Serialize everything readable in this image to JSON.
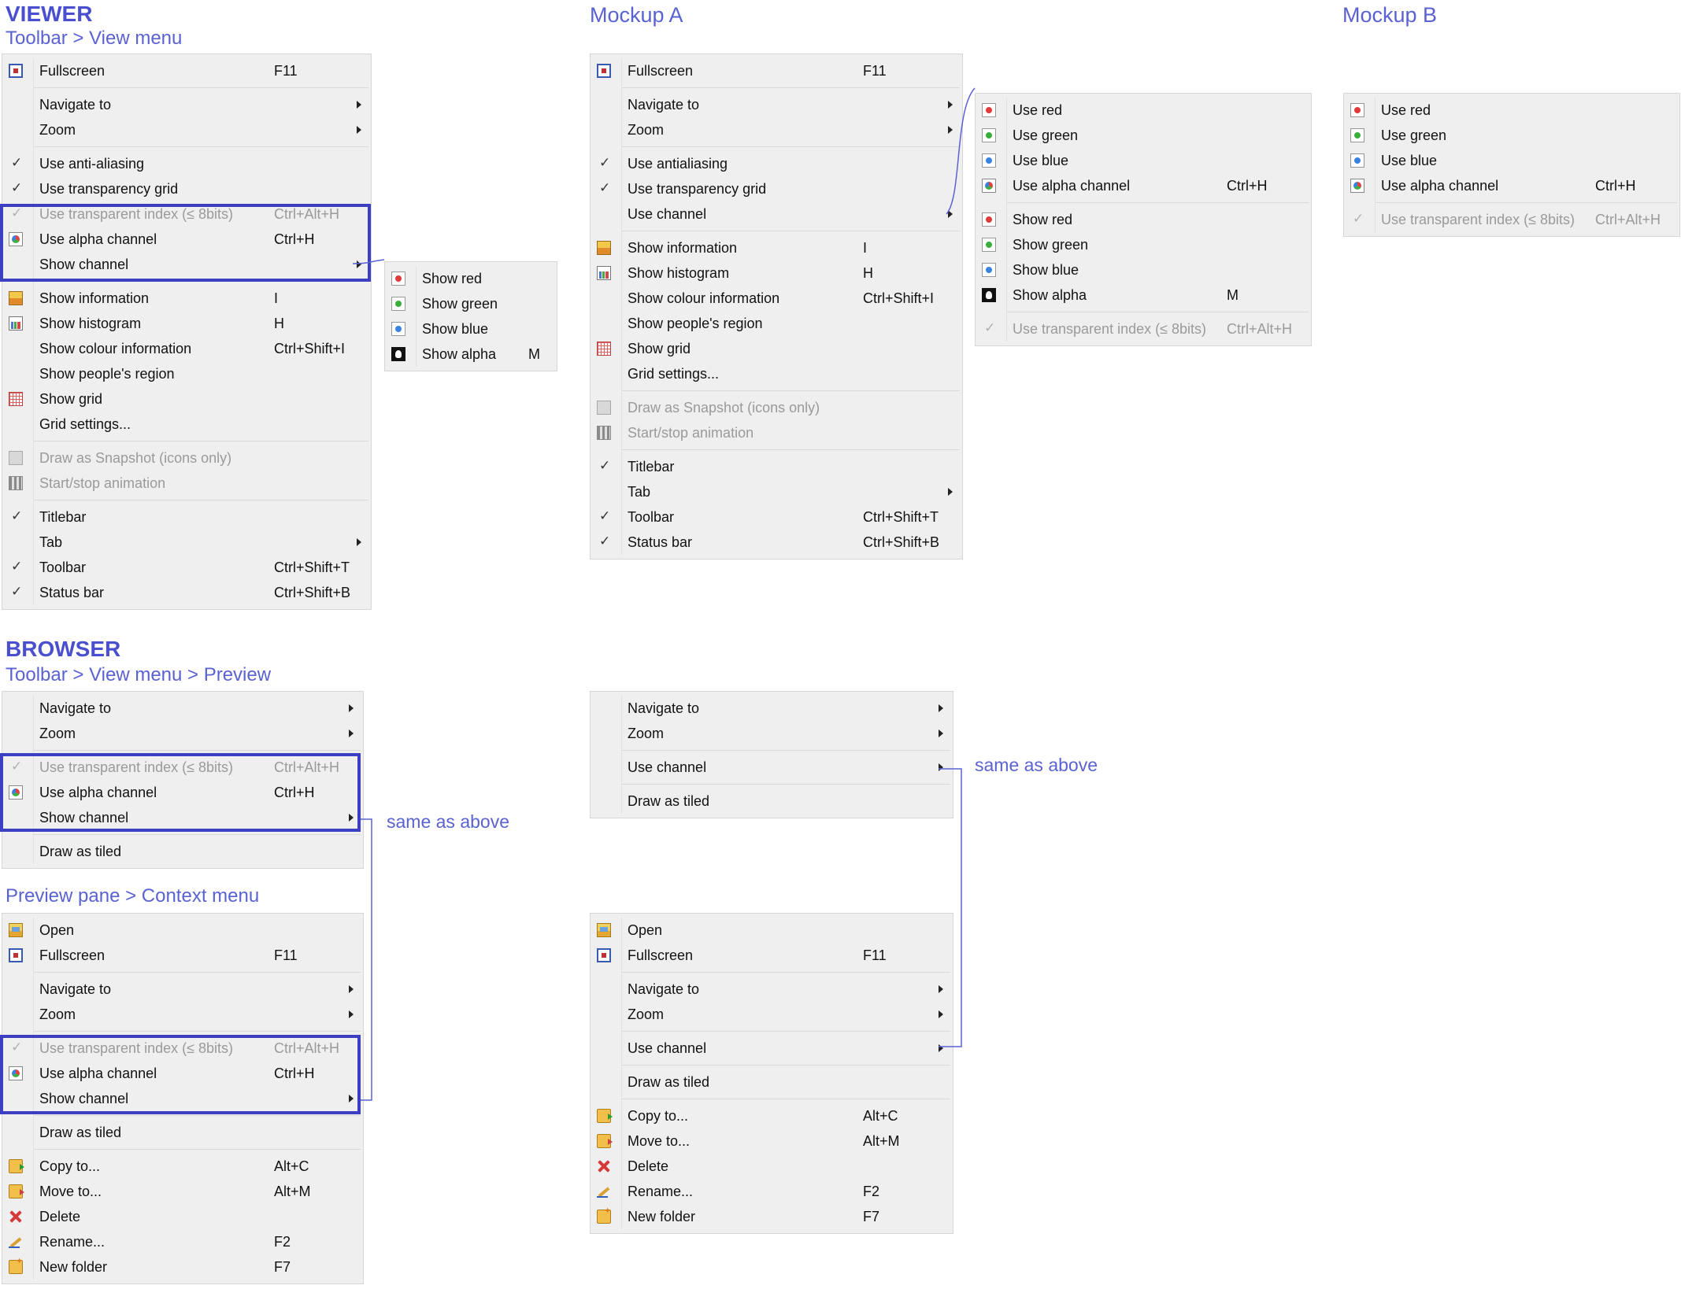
{
  "headings": {
    "viewer": "VIEWER",
    "viewer_path": "Toolbar > View menu",
    "browser": "BROWSER",
    "browser_path": "Toolbar > View menu > Preview",
    "preview_path": "Preview pane > Context menu",
    "mockup_a": "Mockup A",
    "mockup_b": "Mockup B"
  },
  "notes": {
    "same_as_above": "same as above"
  },
  "labels": {
    "fullscreen": "Fullscreen",
    "navigate_to": "Navigate to",
    "zoom": "Zoom",
    "use_anti_aliasing": "Use anti-aliasing",
    "use_antialiasing": "Use antialiasing",
    "use_transparency_grid": "Use transparency grid",
    "use_transparent_index": "Use transparent index (≤ 8bits)",
    "use_alpha_channel": "Use alpha channel",
    "show_channel": "Show channel",
    "use_channel": "Use channel",
    "show_information": "Show information",
    "show_histogram": "Show histogram",
    "show_colour_information": "Show colour information",
    "show_peoples_region": "Show people's region",
    "show_grid": "Show grid",
    "grid_settings": "Grid settings...",
    "draw_as_snapshot": "Draw as Snapshot (icons only)",
    "start_stop_animation": "Start/stop animation",
    "titlebar": "Titlebar",
    "tab": "Tab",
    "toolbar": "Toolbar",
    "status_bar": "Status bar",
    "show_red": "Show red",
    "show_green": "Show green",
    "show_blue": "Show blue",
    "show_alpha": "Show alpha",
    "use_red": "Use red",
    "use_green": "Use green",
    "use_blue": "Use blue",
    "draw_as_tiled": "Draw as tiled",
    "open": "Open",
    "copy_to": "Copy to...",
    "move_to": "Move to...",
    "delete": "Delete",
    "rename": "Rename...",
    "new_folder": "New folder"
  },
  "shortcuts": {
    "fullscreen": "F11",
    "transparent_index": "Ctrl+Alt+H",
    "alpha_channel": "Ctrl+H",
    "information": "I",
    "histogram": "H",
    "colour_information": "Ctrl+Shift+I",
    "toolbar": "Ctrl+Shift+T",
    "status_bar": "Ctrl+Shift+B",
    "show_alpha": "M",
    "copy_to": "Alt+C",
    "move_to": "Alt+M",
    "rename": "F2",
    "new_folder": "F7"
  },
  "colors": {
    "accent": "#4f57cf",
    "highlight_border": "#3d3fc2",
    "menu_background": "#efefef",
    "disabled_text": "#9a9a9a"
  },
  "icons": {
    "fullscreen": "fullscreen-icon",
    "information": "information-icon",
    "histogram": "histogram-icon",
    "grid": "grid-icon",
    "snapshot": "snapshot-icon",
    "animation": "animation-icon",
    "alpha": "alpha-channel-icon",
    "red": "red-channel-icon",
    "green": "green-channel-icon",
    "blue": "blue-channel-icon",
    "show_alpha": "show-alpha-icon",
    "open": "open-icon",
    "copy": "copy-icon",
    "move": "move-icon",
    "delete": "delete-icon",
    "rename": "rename-icon",
    "new_folder": "new-folder-icon",
    "check": "check-icon",
    "submenu": "submenu-arrow-icon"
  }
}
